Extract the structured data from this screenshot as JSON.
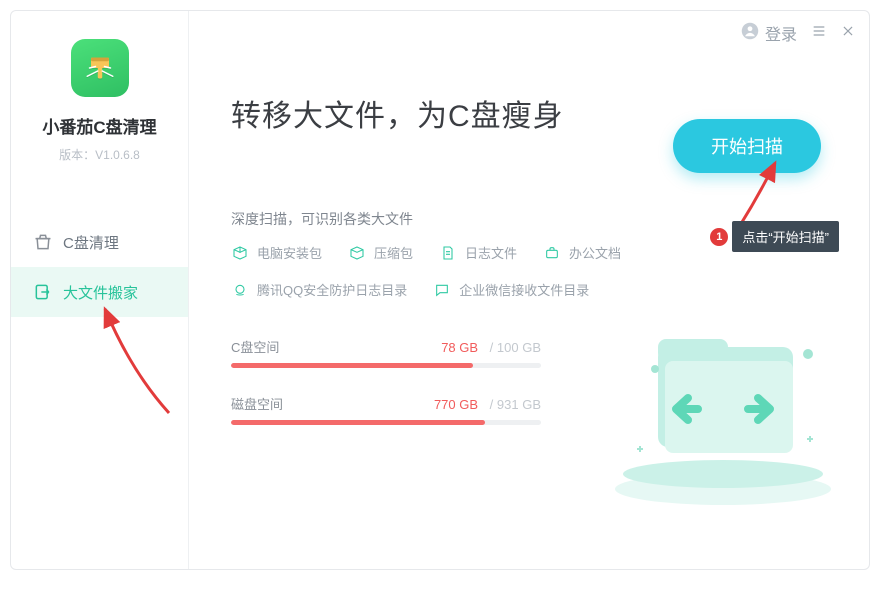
{
  "window": {
    "login": "登录"
  },
  "sidebar": {
    "app_name": "小番茄C盘清理",
    "version": "版本：V1.0.6.8",
    "items": [
      {
        "label": "C盘清理"
      },
      {
        "label": "大文件搬家"
      }
    ]
  },
  "main": {
    "headline": "转移大文件，为C盘瘦身",
    "scan_button": "开始扫描",
    "subhead": "深度扫描，可识别各类大文件",
    "chips": [
      "电脑安装包",
      "压缩包",
      "日志文件",
      "办公文档",
      "腾讯QQ安全防护日志目录",
      "企业微信接收文件目录"
    ],
    "disks": [
      {
        "label": "C盘空间",
        "used": "78 GB",
        "total": "100 GB",
        "pct": 78
      },
      {
        "label": "磁盘空间",
        "used": "770 GB",
        "total": "931 GB",
        "pct": 82
      }
    ]
  },
  "annotation": {
    "badge": "1",
    "text": "点击“开始扫描”"
  }
}
